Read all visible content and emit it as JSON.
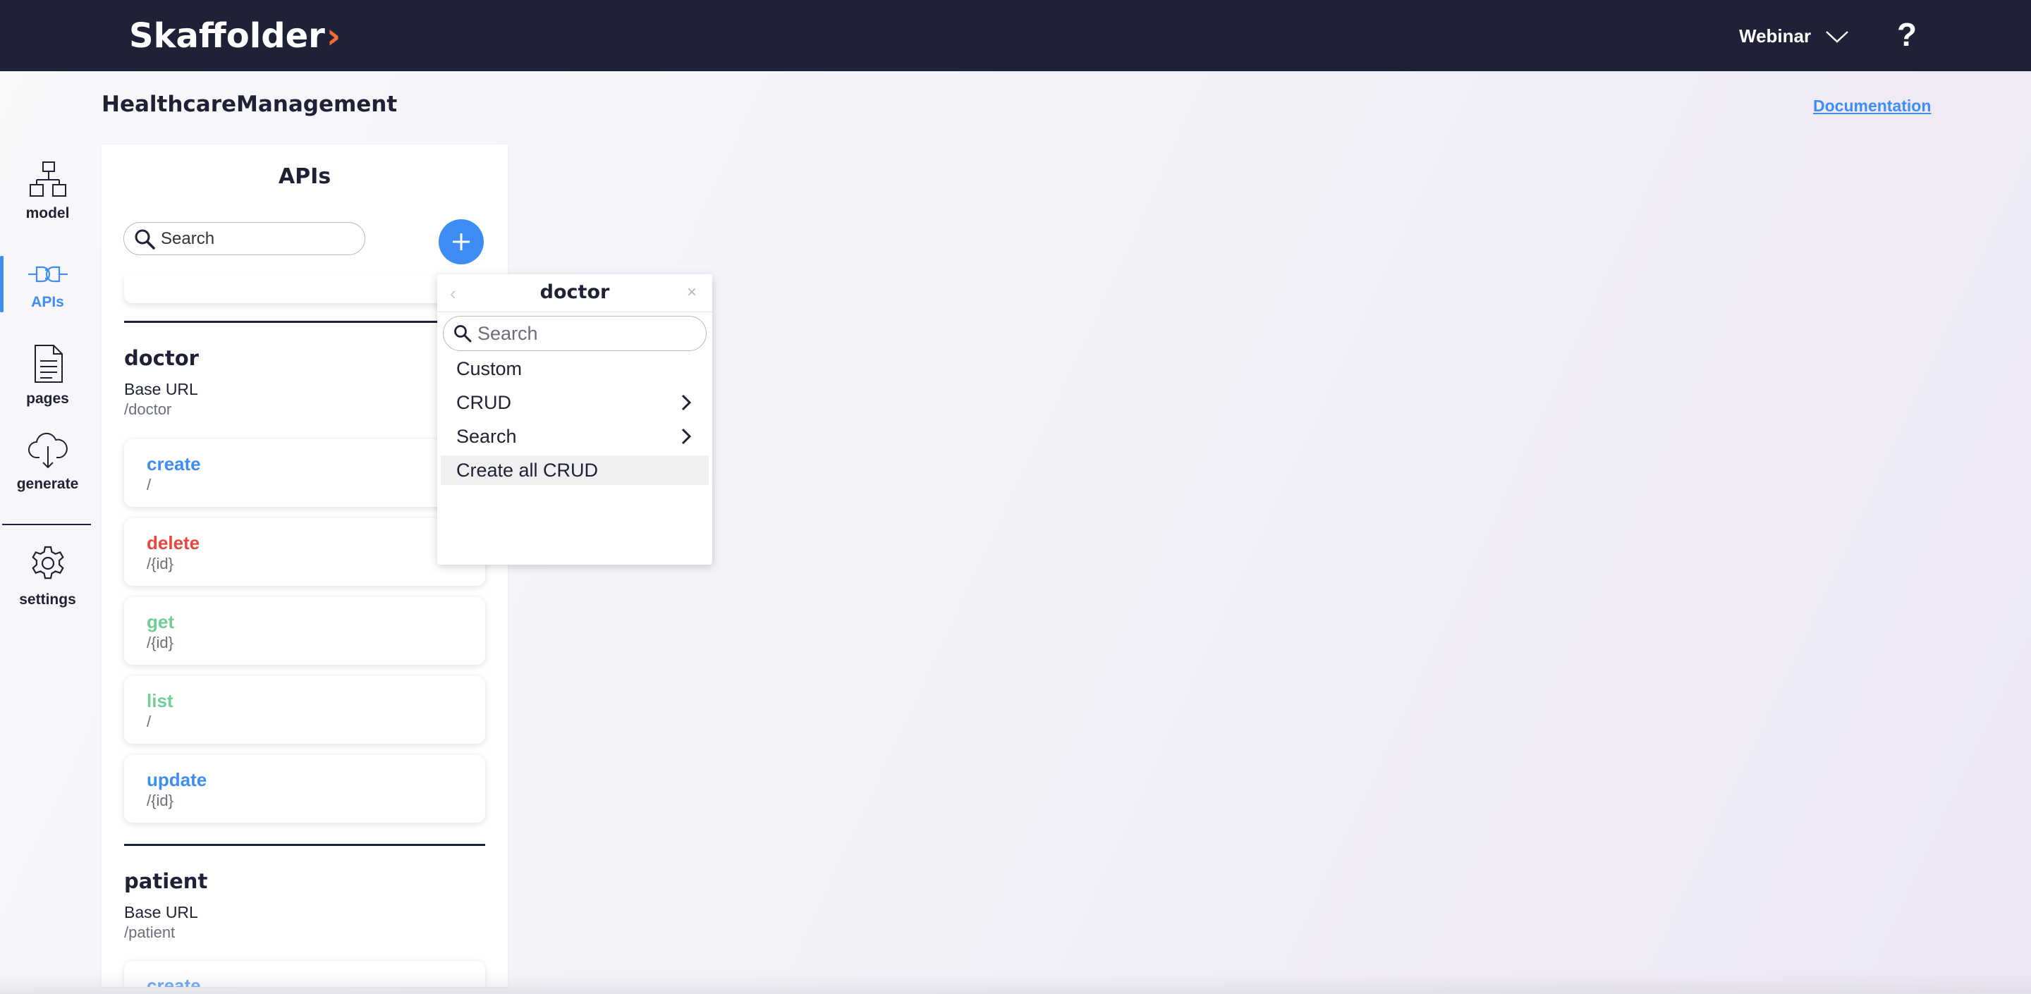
{
  "topbar": {
    "logo_text": "Sk",
    "logo_text_rest": "affolder",
    "logo_tail": "›",
    "project_selector": "Webinar",
    "help_label": "?"
  },
  "nav": {
    "items": [
      {
        "label": "model",
        "icon": "model-icon"
      },
      {
        "label": "APIs",
        "icon": "api-plug-icon",
        "active": true
      },
      {
        "label": "pages",
        "icon": "pages-icon"
      },
      {
        "label": "generate",
        "icon": "cloud-download-icon"
      },
      {
        "label": "settings",
        "icon": "gear-icon"
      }
    ]
  },
  "header": {
    "project_title": "HealthcareManagement",
    "documentation_link": "Documentation"
  },
  "apis_panel": {
    "title": "APIs",
    "search_placeholder": "Search",
    "add_label": "+",
    "sections": [
      {
        "name": "doctor",
        "base_label": "Base URL",
        "base_url": "/doctor",
        "apis": [
          {
            "name": "create",
            "path": "/",
            "color": "#3d8df5"
          },
          {
            "name": "delete",
            "path": "/{id}",
            "color": "#e8483c"
          },
          {
            "name": "get",
            "path": "/{id}",
            "color": "#6fcf97"
          },
          {
            "name": "list",
            "path": "/",
            "color": "#6fcf97"
          },
          {
            "name": "update",
            "path": "/{id}",
            "color": "#3d8df5"
          }
        ]
      },
      {
        "name": "patient",
        "base_label": "Base URL",
        "base_url": "/patient",
        "apis": [
          {
            "name": "create",
            "path": "/",
            "color": "#3d8df5"
          }
        ]
      }
    ]
  },
  "dropdown": {
    "back_label": "‹",
    "title": "doctor",
    "close_label": "×",
    "search_placeholder": "Search",
    "items": [
      {
        "label": "Custom",
        "submenu": false
      },
      {
        "label": "CRUD",
        "submenu": true,
        "arrow": "›"
      },
      {
        "label": "Search",
        "submenu": true,
        "arrow": "›"
      },
      {
        "label": "Create all CRUD",
        "submenu": false,
        "hover": true
      }
    ]
  },
  "colors": {
    "topbar": "#1f2236",
    "accent": "#3d8df5",
    "logo_accent": "#f26b3a",
    "delete": "#e8483c",
    "get_list": "#6fcf97"
  }
}
